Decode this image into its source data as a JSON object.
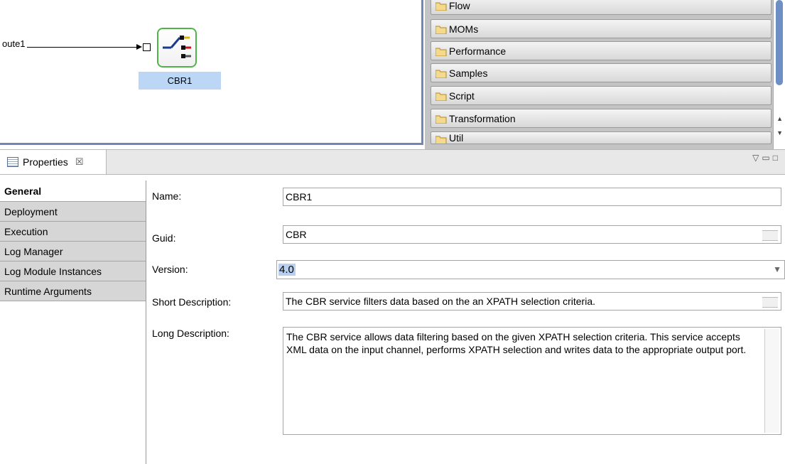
{
  "canvas": {
    "route_label": "oute1",
    "node_label": "CBR1"
  },
  "palette": {
    "items": [
      "Flow",
      "MOMs",
      "Performance",
      "Samples",
      "Script",
      "Transformation",
      "Util"
    ]
  },
  "properties": {
    "tab_title": "Properties",
    "tab_close": "☒",
    "side_tabs": [
      "General",
      "Deployment",
      "Execution",
      "Log Manager",
      "Log Module Instances",
      "Runtime Arguments"
    ],
    "active_side_tab": "General",
    "name_label": "Name:",
    "name_value": "CBR1",
    "guid_label": "Guid:",
    "guid_value": "CBR",
    "version_label": "Version:",
    "version_value": "4.0",
    "short_label": "Short Description:",
    "short_value": "The CBR service filters data based on the an XPATH selection criteria.",
    "long_label": "Long Description:",
    "long_value": "The CBR service allows data filtering based on the given XPATH selection criteria. This service accepts XML data on the input channel, performs XPATH selection and writes data to the appropriate output port."
  },
  "colors": {
    "selection": "#bcd6f6",
    "node_border": "#4fb548",
    "editor_border": "#6f87b5"
  }
}
